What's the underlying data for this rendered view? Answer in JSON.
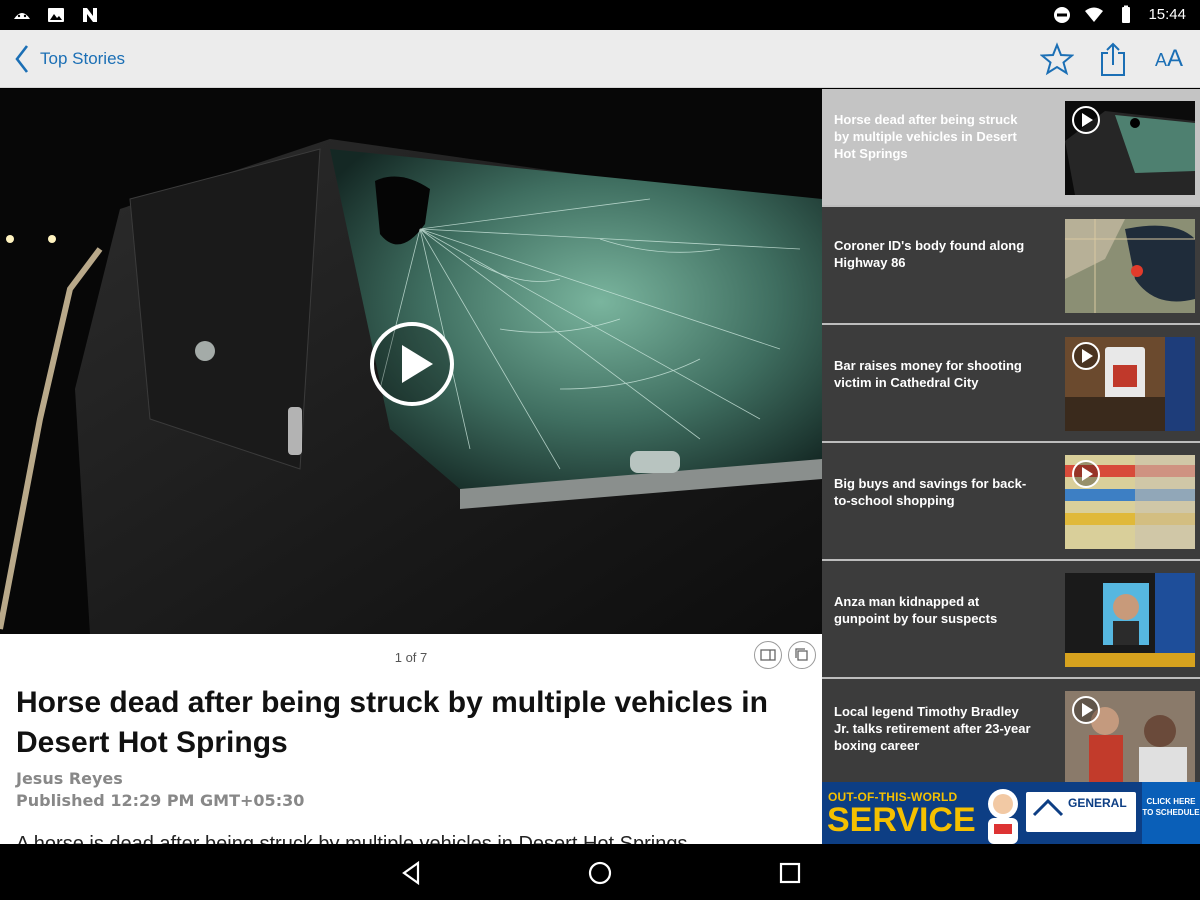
{
  "status_bar": {
    "time": "15:44",
    "icons_left": [
      "android-debug-icon",
      "image-icon",
      "n-app-icon"
    ],
    "icons_right": [
      "do-not-disturb-icon",
      "wifi-icon",
      "battery-icon"
    ]
  },
  "app_bar": {
    "back_label": "Top Stories",
    "actions": [
      "star-icon",
      "share-icon",
      "text-size-icon"
    ],
    "text_size_small": "A",
    "text_size_large": "A"
  },
  "article": {
    "pager": "1 of 7",
    "headline": "Horse dead after being struck by multiple vehicles in Desert Hot Springs",
    "author": "Jesus Reyes",
    "published": "Published 12:29 PM GMT+05:30",
    "body_preview": "A horse is dead after being struck by multiple vehicles in Desert Hot Springs"
  },
  "sidebar": {
    "stories": [
      {
        "title": "Horse dead after being struck by multiple vehicles in Desert Hot Springs",
        "has_video": true,
        "active": true
      },
      {
        "title": "Coroner ID's body found along Highway 86",
        "has_video": false,
        "active": false
      },
      {
        "title": "Bar raises money for shooting victim in Cathedral City",
        "has_video": true,
        "active": false
      },
      {
        "title": "Big buys and savings for back-to-school shopping",
        "has_video": true,
        "active": false
      },
      {
        "title": "Anza man kidnapped at gunpoint by four suspects",
        "has_video": false,
        "active": false
      },
      {
        "title": "Local legend Timothy Bradley Jr. talks retirement after 23-year boxing career",
        "has_video": true,
        "active": false
      }
    ]
  },
  "ad": {
    "line1": "OUT-OF-THIS-WORLD",
    "line2": "SERVICE",
    "brand": "GENERAL",
    "cta": "CLICK HERE TO SCHEDULE"
  },
  "colors": {
    "accent": "#1b6fb5",
    "sidebar_bg": "#3c3c3c",
    "sidebar_active": "#c4c4c4",
    "ad_yellow": "#f5c000",
    "ad_blue": "#0d3e84"
  }
}
